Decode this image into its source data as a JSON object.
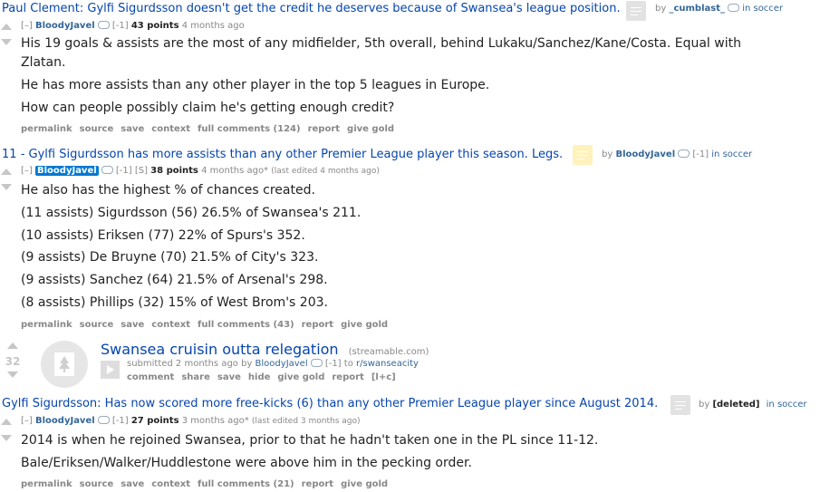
{
  "posts": [
    {
      "title": "Paul Clement: Gylfi Sigurdsson doesn't get the credit he deserves because of Swansea's league position.",
      "by_label": "by",
      "author": "_cumblast_",
      "in_label": "in soccer"
    },
    {
      "rank": "11",
      "sep": "-",
      "title": "Gylfi Sigurdsson has more assists than any other Premier League player this season. Legs.",
      "by_label": "by",
      "author": "BloodyJavel",
      "karma": "[-1]",
      "in_label": "in soccer"
    },
    {
      "title": "Gylfi Sigurdsson: Has now scored more free-kicks (6) than any other Premier League player since August 2014.",
      "by_label": "by",
      "author": "[deleted]",
      "in_label": "in soccer"
    }
  ],
  "comments": [
    {
      "toggle": "[–]",
      "author": "BloodyJavel",
      "karma": "[-1]",
      "points": "43 points",
      "time": "4 months ago",
      "lines": [
        "His 19 goals & assists are the most of any midfielder, 5th overall, behind Lukaku/Sanchez/Kane/Costa. Equal with",
        "Zlatan.",
        "He has more assists than any other player in the top 5 leagues in Europe.",
        "How can people possibly claim he's getting enough credit?"
      ],
      "buttons": [
        "permalink",
        "source",
        "save",
        "context",
        "full comments (124)",
        "report",
        "give gold"
      ]
    },
    {
      "toggle": "[–]",
      "author": "BloodyJavel",
      "karma": "[-1]",
      "flair": "[S]",
      "points": "38 points",
      "time": "4 months ago*",
      "edited": "(last edited 4 months ago)",
      "lines": [
        "He also has the highest % of chances created.",
        "(11 assists) Sigurdsson (56) 26.5% of Swansea's 211.",
        "(10 assists) Eriksen (77) 22% of Spurs's 352.",
        "(9 assists) De Bruyne (70) 21.5% of City's 323.",
        "(9 assists) Sanchez (64) 21.5% of Arsenal's 298.",
        "(8 assists) Phillips (32) 15% of West Brom's 203."
      ],
      "buttons": [
        "permalink",
        "source",
        "save",
        "context",
        "full comments (43)",
        "report",
        "give gold"
      ]
    },
    {
      "toggle": "[–]",
      "author": "BloodyJavel",
      "karma": "[-1]",
      "points": "27 points",
      "time": "3 months ago*",
      "edited": "(last edited 3 months ago)",
      "lines": [
        "2014 is when he rejoined Swansea, prior to that he hadn't taken one in the PL since 11-12.",
        "Bale/Eriksen/Walker/Huddlestone were above him in the pecking order."
      ],
      "buttons": [
        "permalink",
        "source",
        "save",
        "context",
        "full comments (21)",
        "report",
        "give gold"
      ]
    }
  ],
  "link": {
    "score": "32",
    "title": "Swansea cruisin outta relegation",
    "domain": "(streamable.com)",
    "submitted": "submitted 2 months ago by",
    "author": "BloodyJavel",
    "karma": "[-1]",
    "to": "to",
    "subreddit": "r/swanseacity",
    "buttons": [
      "comment",
      "share",
      "save",
      "hide",
      "give gold",
      "report",
      "[l+c]"
    ]
  },
  "icons": {
    "thumbnail": "self-post-icon",
    "link_thumbnail": "tree-default-thumbnail-icon",
    "expand": "play-expando-icon"
  }
}
